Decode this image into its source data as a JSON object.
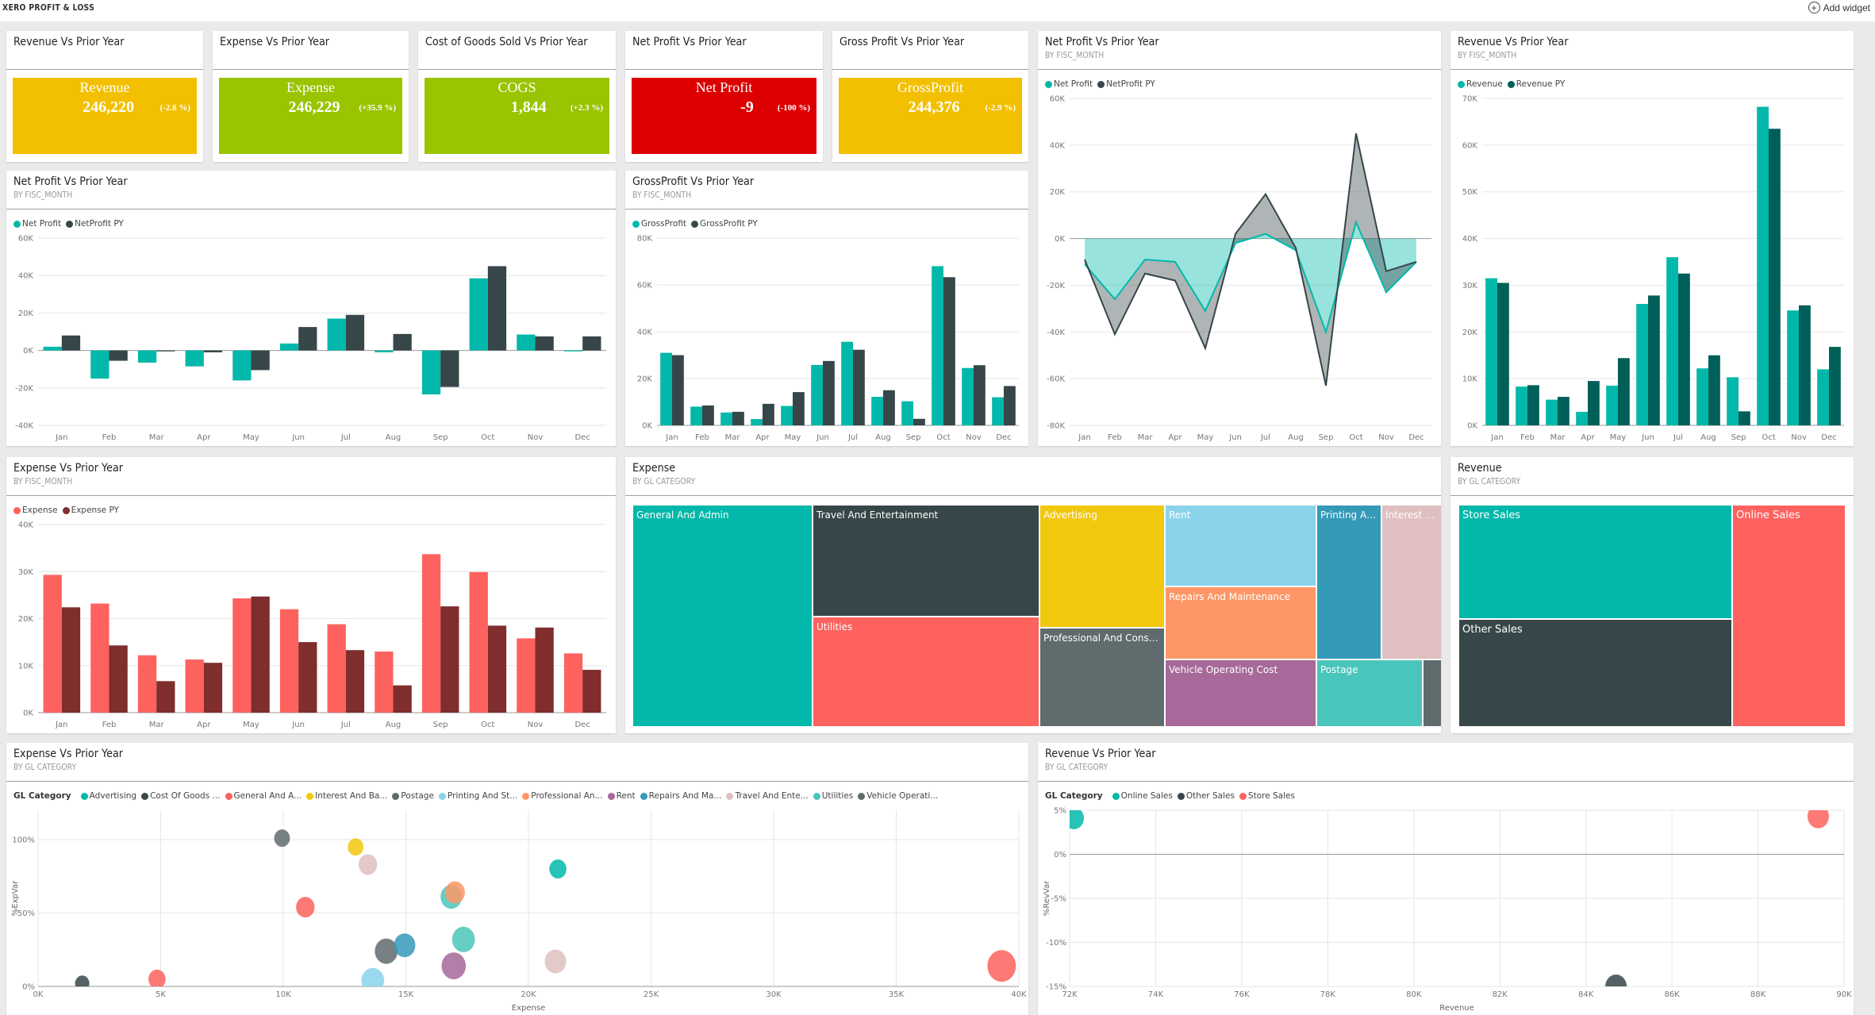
{
  "app": {
    "title": "XERO PROFIT & LOSS",
    "add_widget_label": "Add widget",
    "add_widget_icon": "plus-circle-icon"
  },
  "months": [
    "Jan",
    "Feb",
    "Mar",
    "Apr",
    "May",
    "Jun",
    "Jul",
    "Aug",
    "Sep",
    "Oct",
    "Nov",
    "Dec"
  ],
  "kpis": [
    {
      "title": "Revenue Vs Prior Year",
      "label": "Revenue",
      "value": "246,220",
      "change": "(-2.8 %)",
      "color": "#F2C000"
    },
    {
      "title": "Expense Vs Prior Year",
      "label": "Expense",
      "value": "246,229",
      "change": "(+35.9 %)",
      "color": "#99C400"
    },
    {
      "title": "Cost of Goods Sold Vs Prior Year",
      "label": "COGS",
      "value": "1,844",
      "change": "(+2.3 %)",
      "color": "#99C400"
    },
    {
      "title": "Net Profit Vs Prior Year",
      "label": "Net Profit",
      "value": "-9",
      "change": "(-100 %)",
      "color": "#DD0000"
    },
    {
      "title": "Gross Profit Vs Prior Year",
      "label": "GrossProfit",
      "value": "244,376",
      "change": "(-2.9 %)",
      "color": "#F2C000"
    }
  ],
  "chart_data": [
    {
      "id": "np_line",
      "type": "area",
      "title": "Net Profit Vs Prior Year",
      "subtitle": "BY FISC_MONTH",
      "categories": [
        "Jan",
        "Feb",
        "Mar",
        "Apr",
        "May",
        "Jun",
        "Jul",
        "Aug",
        "Sep",
        "Oct",
        "Nov",
        "Dec"
      ],
      "series": [
        {
          "name": "Net Profit",
          "color": "#01B8AA",
          "values": [
            -11000,
            -26000,
            -9000,
            -10000,
            -31000,
            -2000,
            2000,
            -5000,
            -40000,
            7000,
            -23000,
            -10000
          ]
        },
        {
          "name": "NetProfit PY",
          "color": "#374649",
          "values": [
            -9000,
            -41000,
            -15000,
            -18000,
            -47000,
            2000,
            19000,
            -4000,
            -63000,
            45000,
            -14000,
            -10000
          ]
        }
      ],
      "yticks": [
        "60K",
        "40K",
        "20K",
        "0K",
        "-20K",
        "-40K",
        "-60K",
        "-80K"
      ],
      "ylim": [
        -80000,
        60000
      ],
      "grid": true,
      "legend": "top-left"
    },
    {
      "id": "rev_bar",
      "type": "bar",
      "title": "Revenue Vs Prior Year",
      "subtitle": "BY FISC_MONTH",
      "categories": [
        "Jan",
        "Feb",
        "Mar",
        "Apr",
        "May",
        "Jun",
        "Jul",
        "Aug",
        "Sep",
        "Oct",
        "Nov",
        "Dec"
      ],
      "series": [
        {
          "name": "Revenue",
          "color": "#01B8AA",
          "values": [
            31500,
            8300,
            5500,
            2900,
            8500,
            26000,
            36000,
            12200,
            10300,
            68200,
            24600,
            12000
          ]
        },
        {
          "name": "Revenue PY",
          "color": "#005F58",
          "values": [
            30500,
            8600,
            6100,
            9500,
            14400,
            27800,
            32500,
            15000,
            3000,
            63500,
            25700,
            16800
          ]
        }
      ],
      "yticks": [
        "70K",
        "60K",
        "50K",
        "40K",
        "30K",
        "20K",
        "10K",
        "0K"
      ],
      "ylim": [
        0,
        70000
      ],
      "grid": true,
      "legend": "top-left"
    },
    {
      "id": "np_bar",
      "type": "bar",
      "title": "Net Profit Vs Prior Year",
      "subtitle": "BY FISC_MONTH",
      "categories": [
        "Jan",
        "Feb",
        "Mar",
        "Apr",
        "May",
        "Jun",
        "Jul",
        "Aug",
        "Sep",
        "Oct",
        "Nov",
        "Dec"
      ],
      "series": [
        {
          "name": "Net Profit",
          "color": "#01B8AA",
          "values": [
            2000,
            -15000,
            -6500,
            -8500,
            -16000,
            3700,
            17000,
            -1000,
            -23500,
            38500,
            8500,
            -500
          ]
        },
        {
          "name": "NetProfit PY",
          "color": "#374649",
          "values": [
            8000,
            -5500,
            -500,
            -1000,
            -10500,
            12500,
            19000,
            8800,
            -19500,
            45000,
            7500,
            7500
          ]
        }
      ],
      "yticks": [
        "60K",
        "40K",
        "20K",
        "0K",
        "-20K",
        "-40K"
      ],
      "ylim": [
        -40000,
        60000
      ],
      "grid": true,
      "legend": "top-left"
    },
    {
      "id": "gp_bar",
      "type": "bar",
      "title": "GrossProfit Vs Prior Year",
      "subtitle": "BY FISC_MONTH",
      "categories": [
        "Jan",
        "Feb",
        "Mar",
        "Apr",
        "May",
        "Jun",
        "Jul",
        "Aug",
        "Sep",
        "Oct",
        "Nov",
        "Dec"
      ],
      "series": [
        {
          "name": "GrossProfit",
          "color": "#01B8AA",
          "values": [
            31000,
            8000,
            5500,
            2700,
            8300,
            25800,
            35700,
            12200,
            10300,
            68000,
            24500,
            12000
          ]
        },
        {
          "name": "GrossProfit PY",
          "color": "#374649",
          "values": [
            30000,
            8500,
            5800,
            9200,
            14200,
            27500,
            32300,
            15000,
            2800,
            63300,
            25700,
            16800
          ]
        }
      ],
      "yticks": [
        "80K",
        "60K",
        "40K",
        "20K",
        "0K"
      ],
      "ylim": [
        0,
        80000
      ],
      "grid": true,
      "legend": "top-left"
    },
    {
      "id": "exp_bar",
      "type": "bar",
      "title": "Expense Vs Prior Year",
      "subtitle": "BY FISC_MONTH",
      "categories": [
        "Jan",
        "Feb",
        "Mar",
        "Apr",
        "May",
        "Jun",
        "Jul",
        "Aug",
        "Sep",
        "Oct",
        "Nov",
        "Dec"
      ],
      "series": [
        {
          "name": "Expense",
          "color": "#FD625E",
          "values": [
            29300,
            23200,
            12200,
            11300,
            24300,
            22000,
            18800,
            13000,
            33700,
            29900,
            15800,
            12600
          ]
        },
        {
          "name": "Expense PY",
          "color": "#7F2D2D",
          "values": [
            22400,
            14300,
            6700,
            10600,
            24700,
            15000,
            13300,
            5800,
            22600,
            18500,
            18100,
            9100
          ]
        }
      ],
      "yticks": [
        "40K",
        "30K",
        "20K",
        "10K",
        "0K"
      ],
      "ylim": [
        0,
        40000
      ],
      "grid": true,
      "legend": "top-left"
    },
    {
      "id": "exp_treemap",
      "type": "treemap",
      "title": "Expense",
      "subtitle": "BY GL CATEGORY",
      "items": [
        {
          "label": "General And Admin",
          "color": "#01B8AA"
        },
        {
          "label": "Travel And Entertainment",
          "color": "#374649"
        },
        {
          "label": "Utilities",
          "color": "#FD625E"
        },
        {
          "label": "Advertising",
          "color": "#F2C80F"
        },
        {
          "label": "Professional And Consulti...",
          "color": "#5F6B6D"
        },
        {
          "label": "Rent",
          "color": "#8AD4EB"
        },
        {
          "label": "Repairs And Maintenance",
          "color": "#FE9666"
        },
        {
          "label": "Vehicle Operating Cost",
          "color": "#A66999"
        },
        {
          "label": "Printing An...",
          "color": "#3599B8"
        },
        {
          "label": "Interest An...",
          "color": "#DFBFBF"
        },
        {
          "label": "Postage",
          "color": "#4AC5BB"
        },
        {
          "label": "",
          "color": "#5F6B6D"
        }
      ]
    },
    {
      "id": "rev_treemap",
      "type": "treemap",
      "title": "Revenue",
      "subtitle": "BY GL CATEGORY",
      "items": [
        {
          "label": "Store Sales",
          "color": "#01B8AA"
        },
        {
          "label": "Other Sales",
          "color": "#374649"
        },
        {
          "label": "Online Sales",
          "color": "#FD625E"
        }
      ]
    },
    {
      "id": "exp_scatter",
      "type": "scatter",
      "title": "Expense Vs Prior Year",
      "subtitle": "BY GL CATEGORY",
      "legend_title": "GL Category",
      "legend": [
        {
          "label": "Advertising",
          "color": "#01B8AA"
        },
        {
          "label": "Cost Of Goods ...",
          "color": "#374649"
        },
        {
          "label": "General And A...",
          "color": "#FD625E"
        },
        {
          "label": "Interest And Ba...",
          "color": "#F2C80F"
        },
        {
          "label": "Postage",
          "color": "#5F6B6D"
        },
        {
          "label": "Printing And St...",
          "color": "#8AD4EB"
        },
        {
          "label": "Professional An...",
          "color": "#FE9666"
        },
        {
          "label": "Rent",
          "color": "#A66999"
        },
        {
          "label": "Repairs And Ma...",
          "color": "#3599B8"
        },
        {
          "label": "Travel And Ente...",
          "color": "#DFBFBF"
        },
        {
          "label": "Utilities",
          "color": "#4AC5BB"
        },
        {
          "label": "Vehicle Operati...",
          "color": "#5F6B6D"
        }
      ],
      "points": [
        {
          "x": 1800,
          "y": 2,
          "size": 1,
          "color": "#374649"
        },
        {
          "x": 4850,
          "y": 5,
          "size": 1.2,
          "color": "#FD625E"
        },
        {
          "x": 9950,
          "y": 101,
          "size": 1.1,
          "color": "#5F6B6D"
        },
        {
          "x": 10900,
          "y": 54,
          "size": 1.3,
          "color": "#FD625E"
        },
        {
          "x": 12950,
          "y": 95,
          "size": 1.1,
          "color": "#F2C80F"
        },
        {
          "x": 13450,
          "y": 83,
          "size": 1.3,
          "color": "#DFBFBF"
        },
        {
          "x": 13650,
          "y": 4,
          "size": 1.6,
          "color": "#8AD4EB"
        },
        {
          "x": 14200,
          "y": 24,
          "size": 1.6,
          "color": "#5F6B6D"
        },
        {
          "x": 14950,
          "y": 28,
          "size": 1.5,
          "color": "#3599B8"
        },
        {
          "x": 16850,
          "y": 61,
          "size": 1.5,
          "color": "#4AC5BB"
        },
        {
          "x": 17000,
          "y": 64,
          "size": 1.4,
          "color": "#FE9666"
        },
        {
          "x": 16950,
          "y": 14,
          "size": 1.7,
          "color": "#A66999"
        },
        {
          "x": 17350,
          "y": 32,
          "size": 1.6,
          "color": "#4AC5BB"
        },
        {
          "x": 21200,
          "y": 80,
          "size": 1.2,
          "color": "#01B8AA"
        },
        {
          "x": 21100,
          "y": 17,
          "size": 1.5,
          "color": "#DFBFBF"
        },
        {
          "x": 39300,
          "y": 14,
          "size": 2.0,
          "color": "#FD625E"
        }
      ],
      "xlabel": "Expense",
      "ylabel": "%ExpVar",
      "xticks": [
        "0K",
        "5K",
        "10K",
        "15K",
        "20K",
        "25K",
        "30K",
        "35K",
        "40K"
      ],
      "yticks": [
        "0%",
        "50%",
        "100%"
      ],
      "xlim": [
        0,
        40000
      ],
      "ylim": [
        0,
        120
      ],
      "grid": true
    },
    {
      "id": "rev_scatter",
      "type": "scatter",
      "title": "Revenue Vs Prior Year",
      "subtitle": "BY GL CATEGORY",
      "legend_title": "GL Category",
      "legend": [
        {
          "label": "Online Sales",
          "color": "#01B8AA"
        },
        {
          "label": "Other Sales",
          "color": "#374649"
        },
        {
          "label": "Store Sales",
          "color": "#FD625E"
        }
      ],
      "points": [
        {
          "x": 72100,
          "y": 4.1,
          "size": 1.4,
          "color": "#01B8AA"
        },
        {
          "x": 84700,
          "y": -15,
          "size": 1.5,
          "color": "#374649"
        },
        {
          "x": 89400,
          "y": 4.3,
          "size": 1.5,
          "color": "#FD625E"
        }
      ],
      "xlabel": "Revenue",
      "ylabel": "%RevVar",
      "xticks": [
        "72K",
        "74K",
        "76K",
        "78K",
        "80K",
        "82K",
        "84K",
        "86K",
        "88K",
        "90K"
      ],
      "yticks": [
        "5%",
        "0%",
        "-5%",
        "-10%",
        "-15%"
      ],
      "xlim": [
        72000,
        90000
      ],
      "ylim": [
        -15,
        5
      ],
      "grid": true
    }
  ]
}
